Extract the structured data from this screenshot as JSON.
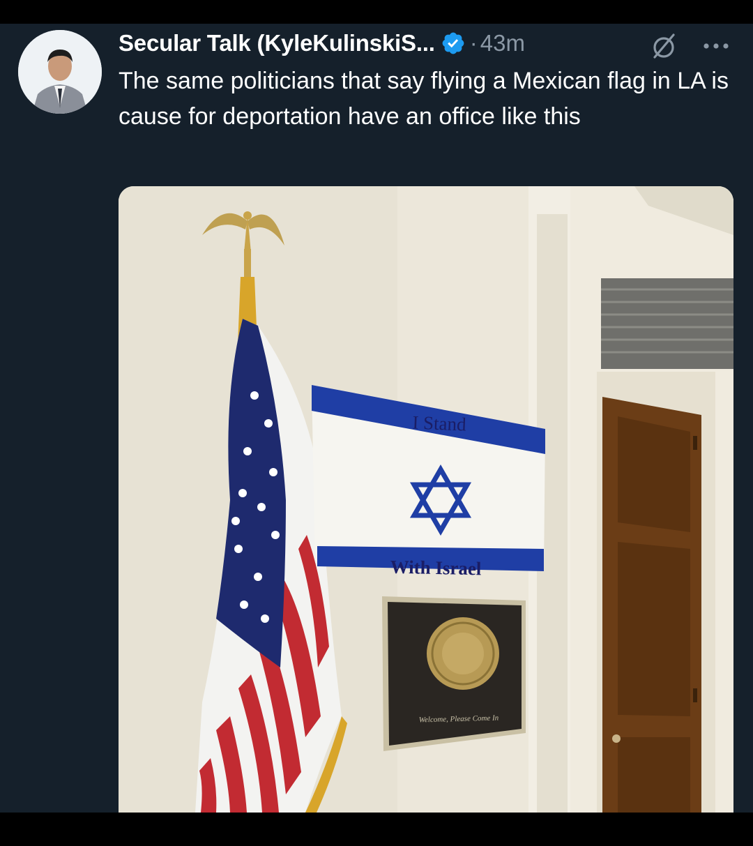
{
  "tweet": {
    "display_name": "Secular Talk (KyleKulinskiS...",
    "separator": "·",
    "time": "43m",
    "text": "The same politicians that say flying a Mexican flag in LA is cause for deportation have an office like this"
  },
  "media": {
    "sign_top_text": "I Stand",
    "sign_bottom_text": "With Israel",
    "plaque_text": "Welcome, Please Come In"
  },
  "icons": {
    "avatar": "avatar",
    "verified": "verified-badge-icon",
    "grok": "grok-icon",
    "more": "more-icon"
  },
  "colors": {
    "background": "#15202b",
    "text_primary": "#ffffff",
    "text_secondary": "#8b98a5",
    "verified_blue": "#1d9bf0",
    "israel_blue": "#1f3ea5"
  }
}
